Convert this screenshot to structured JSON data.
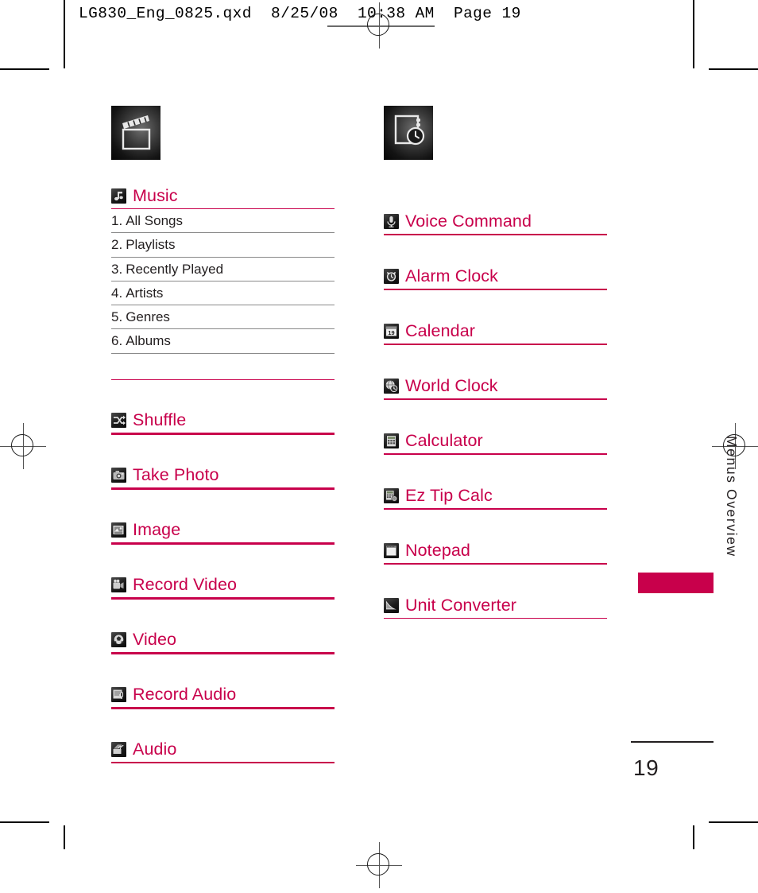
{
  "page": {
    "slug": "LG830_Eng_0825.qxd  8/25/08  10:38 AM  Page 19",
    "folio": "19",
    "rail_label": "Menus Overview",
    "accent_color": "#c8004b",
    "text_color": "#231f20"
  },
  "columns": [
    {
      "id": "left",
      "section_icon": "clapperboard-icon",
      "entries": [
        {
          "title": "Music",
          "icon": "music-note-icon",
          "sub_items": [
            {
              "num": "1.",
              "label": "All Songs"
            },
            {
              "num": "2.",
              "label": "Playlists"
            },
            {
              "num": "3.",
              "label": "Recently Played"
            },
            {
              "num": "4.",
              "label": "Artists"
            },
            {
              "num": "5.",
              "label": "Genres"
            },
            {
              "num": "6.",
              "label": "Albums"
            }
          ]
        },
        {
          "title": "Shuffle",
          "icon": "shuffle-icon",
          "sub_items": []
        },
        {
          "title": "Take Photo",
          "icon": "camera-icon",
          "sub_items": []
        },
        {
          "title": "Image",
          "icon": "image-icon",
          "sub_items": []
        },
        {
          "title": "Record Video",
          "icon": "camcorder-icon",
          "sub_items": []
        },
        {
          "title": "Video",
          "icon": "video-ball-icon",
          "sub_items": []
        },
        {
          "title": "Record Audio",
          "icon": "microphone-page-icon",
          "sub_items": []
        },
        {
          "title": "Audio",
          "icon": "audio-speaker-icon",
          "sub_items": []
        }
      ]
    },
    {
      "id": "right",
      "section_icon": "notepad-clock-icon",
      "entries": [
        {
          "title": "Voice Command",
          "icon": "microphone-icon",
          "sub_items": []
        },
        {
          "title": "Alarm Clock",
          "icon": "alarm-clock-icon",
          "sub_items": []
        },
        {
          "title": "Calendar",
          "icon": "calendar-icon",
          "icon_text": "19",
          "sub_items": []
        },
        {
          "title": "World Clock",
          "icon": "globe-clock-icon",
          "sub_items": []
        },
        {
          "title": "Calculator",
          "icon": "calculator-icon",
          "sub_items": []
        },
        {
          "title": "Ez Tip Calc",
          "icon": "tip-calculator-icon",
          "sub_items": []
        },
        {
          "title": "Notepad",
          "icon": "notepad-icon",
          "sub_items": []
        },
        {
          "title": "Unit Converter",
          "icon": "unit-converter-icon",
          "sub_items": []
        }
      ]
    }
  ]
}
